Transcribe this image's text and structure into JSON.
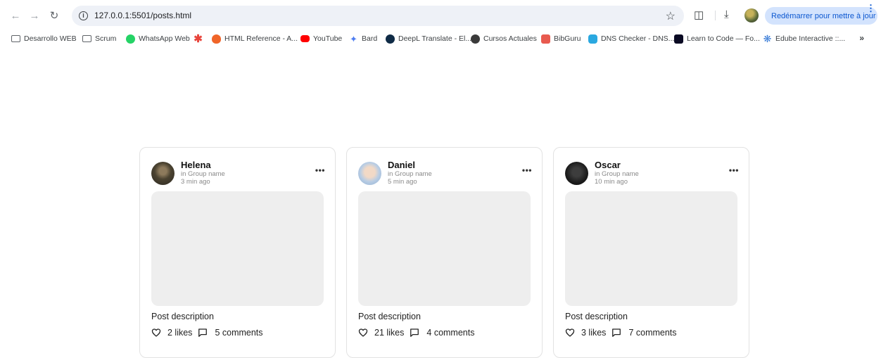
{
  "browser": {
    "url": "127.0.0.1:5501/posts.html",
    "update_label": "Redémarrer pour mettre à jour",
    "accent": "#0b57d0"
  },
  "bookmarks": [
    {
      "label": "Desarrollo WEB",
      "icon": "folder-icon"
    },
    {
      "label": "Scrum",
      "icon": "folder-icon"
    },
    {
      "label": "WhatsApp Web",
      "icon": "whatsapp-icon"
    },
    {
      "label": "",
      "icon": "asterisk-icon"
    },
    {
      "label": "HTML Reference - A...",
      "icon": "html-icon"
    },
    {
      "label": "YouTube",
      "icon": "youtube-icon"
    },
    {
      "label": "Bard",
      "icon": "bard-icon"
    },
    {
      "label": "DeepL Translate - El...",
      "icon": "deepl-icon"
    },
    {
      "label": "Cursos Actuales",
      "icon": "cursos-icon"
    },
    {
      "label": "BibGuru",
      "icon": "bibguru-icon"
    },
    {
      "label": "DNS Checker - DNS...",
      "icon": "dns-icon"
    },
    {
      "label": "Learn to Code — Fo...",
      "icon": "freecodecamp-icon"
    },
    {
      "label": "Edube Interactive ::...",
      "icon": "edube-icon"
    }
  ],
  "posts": [
    {
      "name": "Helena",
      "group": "in Group name",
      "time": "3 min ago",
      "description": "Post description",
      "likes": "2 likes",
      "comments": "5 comments"
    },
    {
      "name": "Daniel",
      "group": "in Group name",
      "time": "5 min ago",
      "description": "Post description",
      "likes": "21 likes",
      "comments": "4 comments"
    },
    {
      "name": "Oscar",
      "group": "in Group name",
      "time": "10 min ago",
      "description": "Post description",
      "likes": "3 likes",
      "comments": "7 comments"
    }
  ]
}
